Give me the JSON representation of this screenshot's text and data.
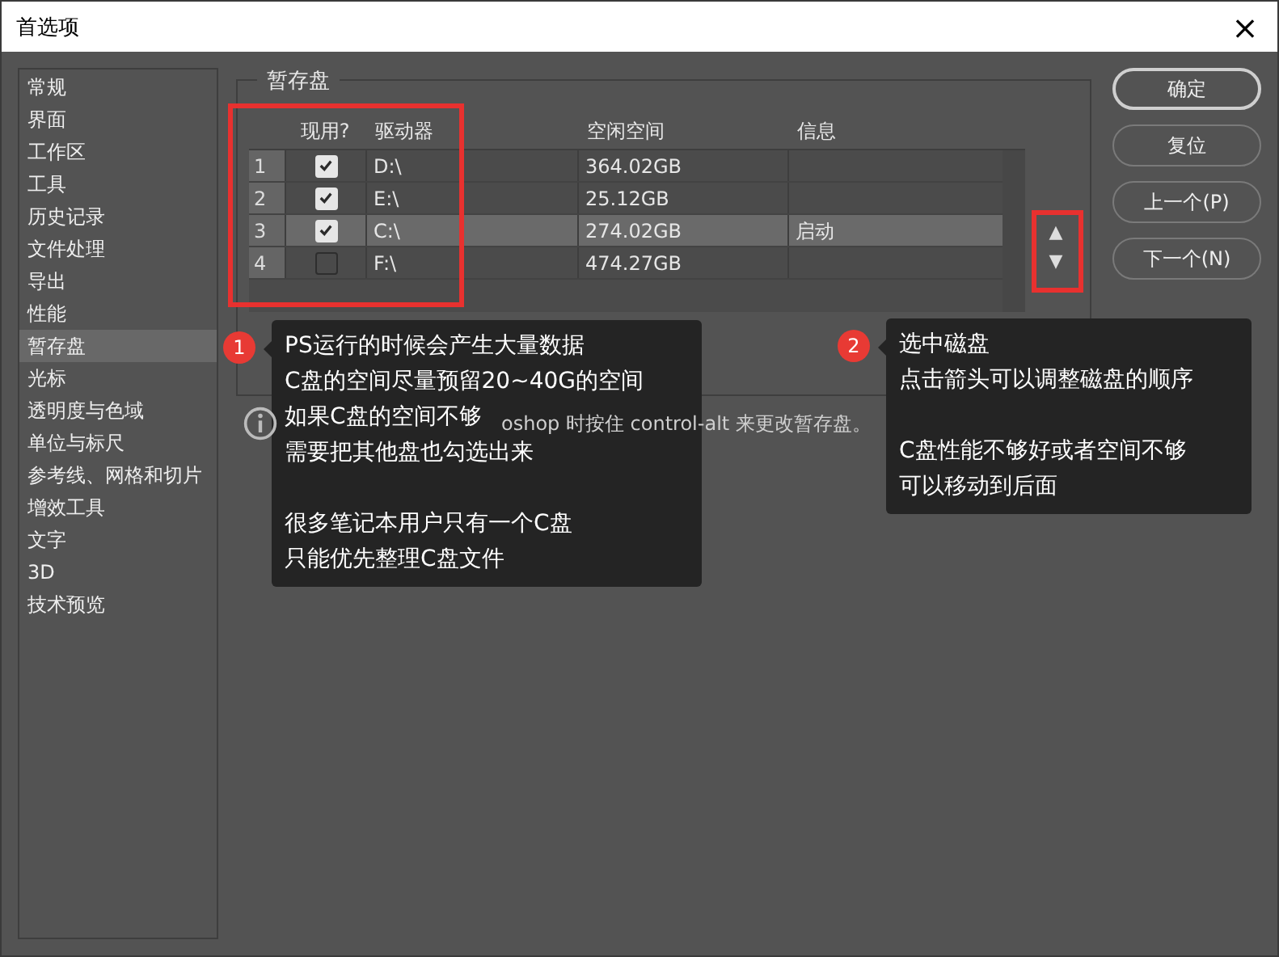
{
  "window": {
    "title": "首选项",
    "close": "×"
  },
  "sidebar": {
    "items": [
      {
        "label": "常规",
        "selected": false
      },
      {
        "label": "界面",
        "selected": false
      },
      {
        "label": "工作区",
        "selected": false
      },
      {
        "label": "工具",
        "selected": false
      },
      {
        "label": "历史记录",
        "selected": false
      },
      {
        "label": "文件处理",
        "selected": false
      },
      {
        "label": "导出",
        "selected": false
      },
      {
        "label": "性能",
        "selected": false
      },
      {
        "label": "暂存盘",
        "selected": true
      },
      {
        "label": "光标",
        "selected": false
      },
      {
        "label": "透明度与色域",
        "selected": false
      },
      {
        "label": "单位与标尺",
        "selected": false
      },
      {
        "label": "参考线、网格和切片",
        "selected": false
      },
      {
        "label": "增效工具",
        "selected": false
      },
      {
        "label": "文字",
        "selected": false
      },
      {
        "label": "3D",
        "selected": false
      },
      {
        "label": "技术预览",
        "selected": false
      }
    ]
  },
  "group": {
    "title": "暂存盘"
  },
  "table": {
    "columns": [
      "现用?",
      "驱动器",
      "空闲空间",
      "信息"
    ],
    "rows": [
      {
        "index": "1",
        "active": true,
        "drive": "D:\\",
        "free": "364.02GB",
        "selected": false
      },
      {
        "index": "2",
        "active": true,
        "drive": "E:\\",
        "free": "25.12GB",
        "selected": false
      },
      {
        "index": "3",
        "active": true,
        "drive": "C:\\",
        "free": "274.02GB",
        "info": "启动",
        "selected": true
      },
      {
        "index": "4",
        "active": false,
        "drive": "F:\\",
        "free": "474.27GB",
        "selected": false
      }
    ]
  },
  "order_arrows": {
    "up": "▲",
    "down": "▼"
  },
  "info_note": "oshop 时按住 control-alt 来更改暂存盘。",
  "buttons": [
    {
      "label": "确定",
      "default": true
    },
    {
      "label": "复位",
      "default": false
    },
    {
      "label": "上一个(P)",
      "default": false
    },
    {
      "label": "下一个(N)",
      "default": false
    }
  ],
  "callouts": [
    {
      "number": "1",
      "paragraphs": [
        [
          "PS运行的时候会产生大量数据",
          "C盘的空间尽量预留20~40G的空间",
          "如果C盘的空间不够",
          "需要把其他盘也勾选出来"
        ],
        [
          "很多笔记本用户只有一个C盘",
          "只能优先整理C盘文件"
        ]
      ]
    },
    {
      "number": "2",
      "paragraphs": [
        [
          "选中磁盘",
          "点击箭头可以调整磁盘的顺序"
        ],
        [
          "C盘性能不够好或者空间不够",
          "可以移动到后面"
        ]
      ]
    }
  ]
}
